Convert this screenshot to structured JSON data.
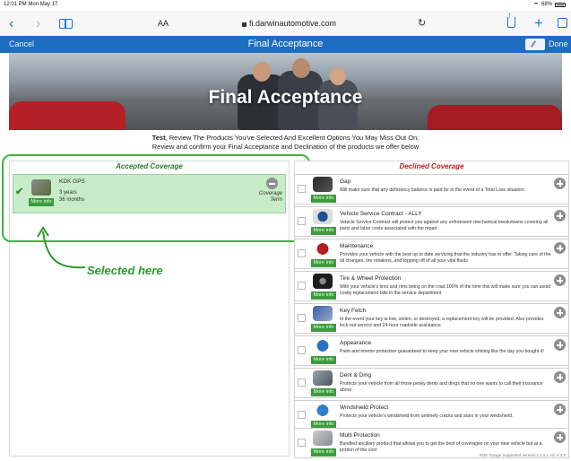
{
  "status_bar": {
    "time": "12:01 PM  Mon May 17",
    "battery": "68%"
  },
  "browser": {
    "text_size": "AA",
    "url": "fi.darwinautomotive.com"
  },
  "app_header": {
    "cancel": "Cancel",
    "title": "Final Acceptance",
    "done": "Done"
  },
  "hero": {
    "caption": "Final Acceptance"
  },
  "intro": {
    "line1_name": "Test",
    "line1_rest": ", Review The Products You've Selected And Excellent Options You May Miss Out On.",
    "line2": "Review and confirm your Final Acceptance and Declination of the products we offer below"
  },
  "accepted": {
    "heading": "Accepted Coverage",
    "items": [
      {
        "name": "KDK GPS",
        "term_years": "3 years",
        "term_months": "36 months",
        "more_info": "More info",
        "coverage_label": "Coverage",
        "term_label": "Term"
      }
    ]
  },
  "annotation": {
    "selected_label": "Selected here"
  },
  "declined": {
    "heading": "Declined Coverage",
    "items": [
      {
        "name": "Gap",
        "desc": "Will make sure that any deficiency balance is paid for in the event of a Total Loss situation",
        "more_info": "More info"
      },
      {
        "name": "Vehicle Service Contract - ALLY",
        "desc": "Vehicle Service Contract will protect you against any unforeseen mechanical breakdowns covering all parts and labor costs associated with the repair",
        "more_info": "More info"
      },
      {
        "name": "Maintenance",
        "desc": "Provides your vehicle with the best up to date servicing that the industry has to offer. Taking care of the oil changes, tire rotations, and topping off of all your vital fluids.",
        "more_info": "More info"
      },
      {
        "name": "Tire & Wheel Protection",
        "desc": "With your vehicle's tires and rims being on the road 100% of the time this will make sure you can avoid costly replacement bills in the service department",
        "more_info": "More info"
      },
      {
        "name": "Key Fetch",
        "desc": "In the event your key is lost, stolen, or destroyed, a replacement key will be provided. Also provides lock-out service and 24-hour roadside assistance.",
        "more_info": "More info"
      },
      {
        "name": "Appearance",
        "desc": "Paint and interior protection guaranteed to keep your new vehicle shining like the day you bought it!",
        "more_info": "More info"
      },
      {
        "name": "Dent & Ding",
        "desc": "Protects your vehicle from all those pesky dents and dings that no one wants to call their insurance about",
        "more_info": "More info"
      },
      {
        "name": "Windshield Protect",
        "desc": "Protects your vehicle's windshield from untimely cracks and stars in your windshield.",
        "more_info": "More info"
      },
      {
        "name": "Multi Protection",
        "desc": "Bundled ancillary product that allows you to get the best of coverages on your new vehicle but at a portion of the cost",
        "more_info": "More info"
      }
    ]
  },
  "footer": "KDK Gauge Supported version:1.3.1.1 Ad: 9.3.0"
}
